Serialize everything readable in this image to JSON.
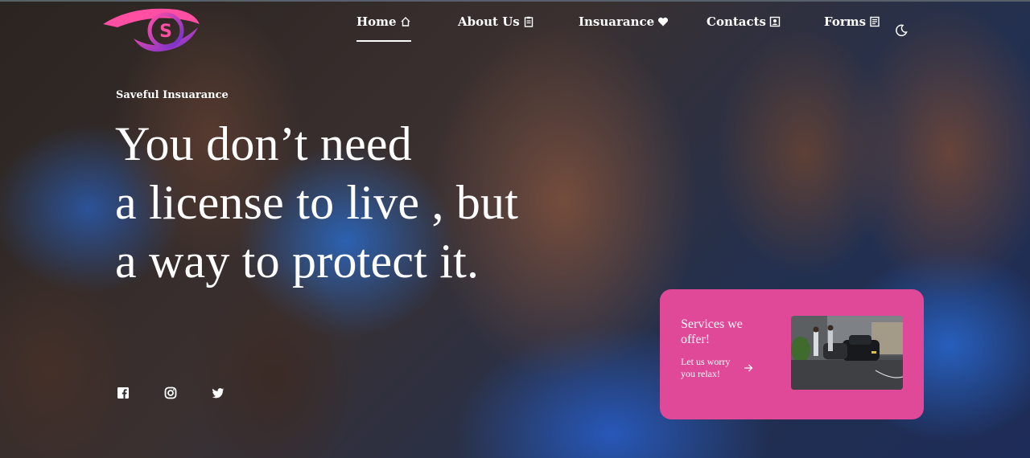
{
  "brand": {
    "logo_letter": "S",
    "accent": "#e04898"
  },
  "nav": {
    "items": [
      {
        "label": "Home",
        "icon": "home-icon",
        "active": true
      },
      {
        "label": "About Us",
        "icon": "clipboard-icon",
        "active": false
      },
      {
        "label": "Insuarance",
        "icon": "heart-icon",
        "active": false
      },
      {
        "label": "Contacts",
        "icon": "contact-card-icon",
        "active": false
      },
      {
        "label": "Forms",
        "icon": "document-icon",
        "active": false
      }
    ],
    "theme_toggle_icon": "moon-icon"
  },
  "hero": {
    "eyebrow": "Saveful Insuarance",
    "headline": [
      "You don’t need",
      "a license to live , but",
      "a way to protect it."
    ]
  },
  "social": {
    "icons": [
      "facebook-icon",
      "instagram-icon",
      "twitter-icon"
    ]
  },
  "services_card": {
    "title": "Services we offer!",
    "link_text": "Let us worry you relax!",
    "arrow_icon": "arrow-right-icon",
    "bg_color": "#e04898"
  }
}
